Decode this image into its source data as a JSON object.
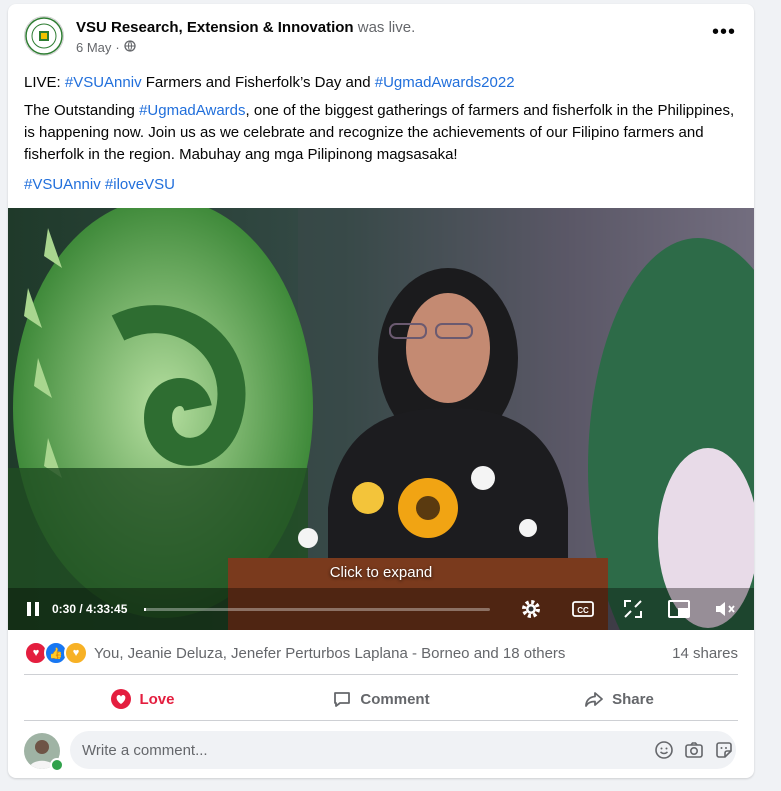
{
  "post": {
    "page_name": "VSU Research, Extension & Innovation",
    "status": "was live.",
    "date": "6 May",
    "separator": "·",
    "live_prefix": "LIVE: ",
    "live_tag_1": "#VSUAnniv",
    "live_middle": " Farmers and Fisherfolk’s Day and ",
    "live_tag_2": "#UgmadAwards2022",
    "body_start": "The Outstanding ",
    "body_tag": "#UgmadAwards",
    "body_rest": ", one of the biggest gatherings of farmers and fisherfolk in the Philippines, is happening now. Join us as we celebrate and recognize the achievements of our Filipino farmers and fisherfolk in the region. Mabuhay ang mga Pilipinong magsasaka!",
    "hashtag_1": "#VSUAnniv",
    "hashtag_2": "#iloveVSU"
  },
  "video": {
    "expand_label": "Click to expand",
    "time": "0:30 / 4:33:45",
    "progress": 0.0018
  },
  "reactions": {
    "icons": [
      "love",
      "like",
      "care"
    ],
    "names": "You, Jeanie Deluza, Jenefer Perturbos Laplana - Borneo and 18 others",
    "shares": "14 shares"
  },
  "actions": {
    "love": "Love",
    "comment": "Comment",
    "share": "Share"
  },
  "comment_box": {
    "placeholder": "Write a comment..."
  },
  "colors": {
    "link": "#216fdb",
    "love": "#e41e3f",
    "like": "#1877f2",
    "online": "#31a24c"
  }
}
